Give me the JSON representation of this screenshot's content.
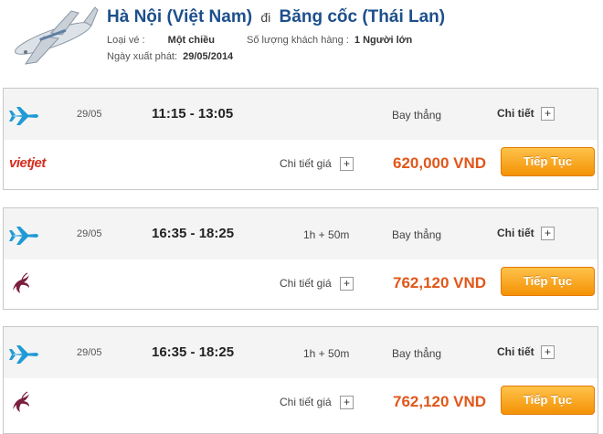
{
  "header": {
    "origin": "Hà Nội (Việt Nam)",
    "connector": "đi",
    "destination": "Băng cốc (Thái Lan)",
    "ticket_type_label": "Loại vé :",
    "ticket_type_value": "Một chiều",
    "passengers_label": "Số lượng khách hàng :",
    "passengers_value": "1 Người lớn",
    "departure_date_label": "Ngày xuất phát:",
    "departure_date_value": "29/05/2014"
  },
  "flights": [
    {
      "date": "29/05",
      "times": "11:15 - 13:05",
      "duration": "",
      "stops": "Bay thẳng",
      "detail_label": "Chi tiết",
      "airline_logo_text": "vietjet",
      "price_detail_label": "Chi tiết giá",
      "price": "620,000 VND",
      "button_label": "Tiếp Tục"
    },
    {
      "date": "29/05",
      "times": "16:35 - 18:25",
      "duration": "1h + 50m",
      "stops": "Bay thẳng",
      "detail_label": "Chi tiết",
      "price_detail_label": "Chi tiết giá",
      "price": "762,120 VND",
      "button_label": "Tiếp Tục"
    },
    {
      "date": "29/05",
      "times": "16:35 - 18:25",
      "duration": "1h + 50m",
      "stops": "Bay thẳng",
      "detail_label": "Chi tiết",
      "price_detail_label": "Chi tiết giá",
      "price": "762,120 VND",
      "button_label": "Tiếp Tục"
    }
  ],
  "icons": {
    "plus": "+",
    "plane": "plane-icon",
    "logo": "airplane-logo-icon",
    "qatar": "qatar-oryx-icon"
  },
  "colors": {
    "title": "#1d4f8c",
    "price": "#e0571a",
    "button": "#f39205",
    "vietjet": "#d42e20",
    "qatar": "#7a1f3d",
    "plane": "#1f9ad6"
  }
}
